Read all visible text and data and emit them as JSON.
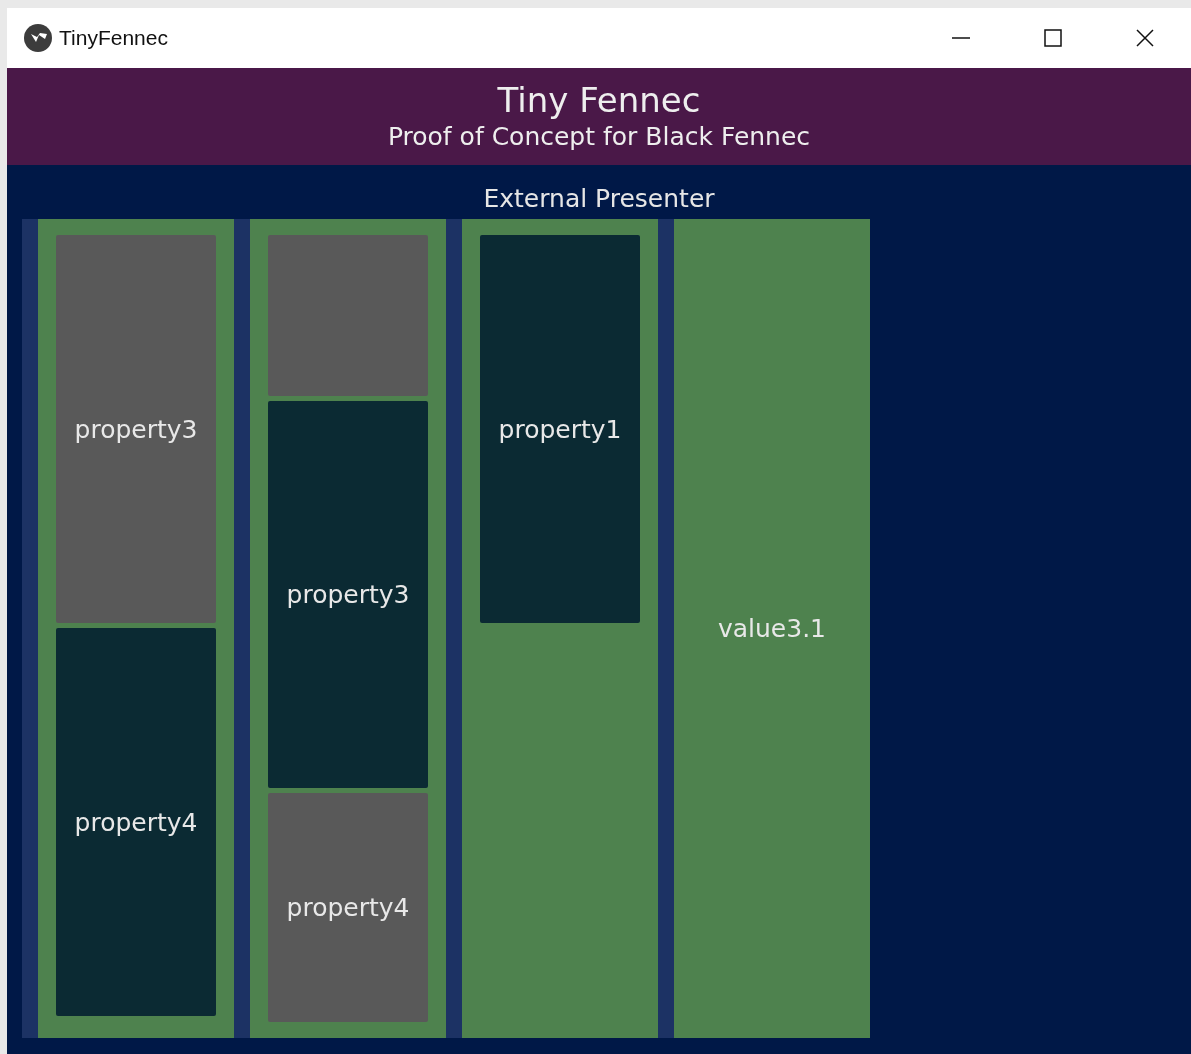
{
  "window": {
    "title": "TinyFennec"
  },
  "header": {
    "title": "Tiny Fennec",
    "subtitle": "Proof of Concept for Black Fennec"
  },
  "presenter": {
    "title": "External Presenter",
    "columns": [
      {
        "cells": [
          {
            "label": "property3",
            "selected": true
          },
          {
            "label": "property4",
            "selected": false
          }
        ]
      },
      {
        "cells": [
          {
            "selected": true
          },
          {
            "label": "property3",
            "selected": false
          },
          {
            "label": "property4",
            "selected": true
          }
        ]
      },
      {
        "cells": [
          {
            "label": "property1",
            "selected": false
          }
        ]
      },
      {
        "value": "value3.1"
      }
    ]
  }
}
